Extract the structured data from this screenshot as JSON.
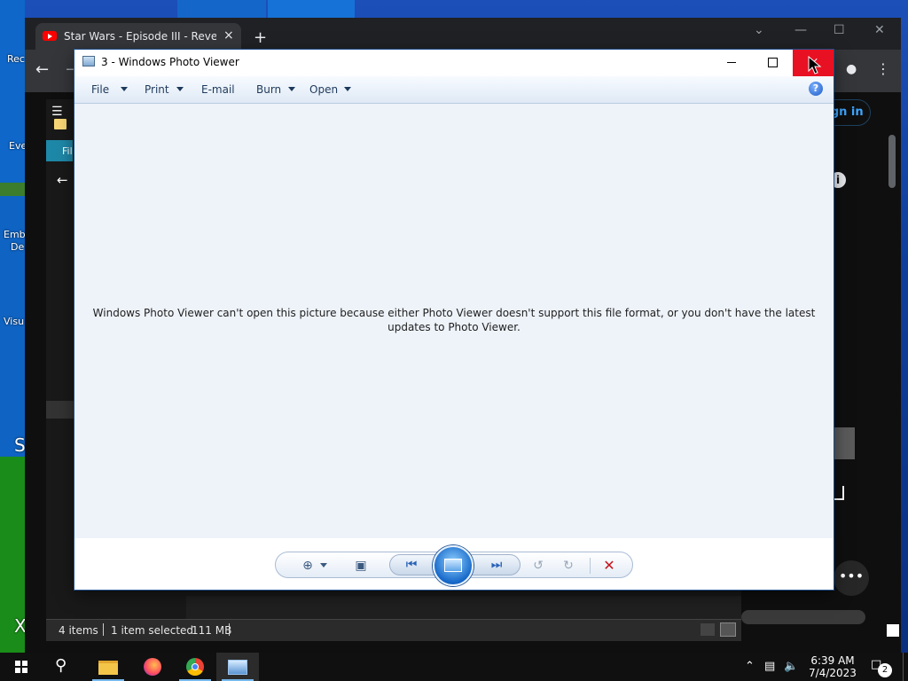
{
  "desktop": {
    "labels": [
      "Rec",
      "Eve",
      "Emb",
      "De",
      "Visu",
      "S",
      "X"
    ]
  },
  "chrome": {
    "tab_title": "Star Wars - Episode III - Revenge",
    "tab_close": "×",
    "new_tab": "+",
    "yt_signin": "Sign in"
  },
  "explorer": {
    "ribbon_tab": "Fil",
    "status": {
      "items": "4 items",
      "selected": "1 item selected",
      "size": "111 MB"
    }
  },
  "photo_viewer": {
    "title": "3 - Windows Photo Viewer",
    "menu": {
      "file": "File",
      "print": "Print",
      "email": "E-mail",
      "burn": "Burn",
      "open": "Open"
    },
    "help": "?",
    "message": "Windows Photo Viewer can't open this picture because either Photo Viewer doesn't support this file format, or you don't have the latest updates to Photo Viewer."
  },
  "taskbar": {
    "time": "6:39 AM",
    "date": "7/4/2023",
    "notification_count": "2"
  },
  "colors": {
    "close_red": "#e81123",
    "menubar_text": "#1e395b",
    "canvas_bg": "#eef3fa",
    "taskbar": "#101010"
  }
}
